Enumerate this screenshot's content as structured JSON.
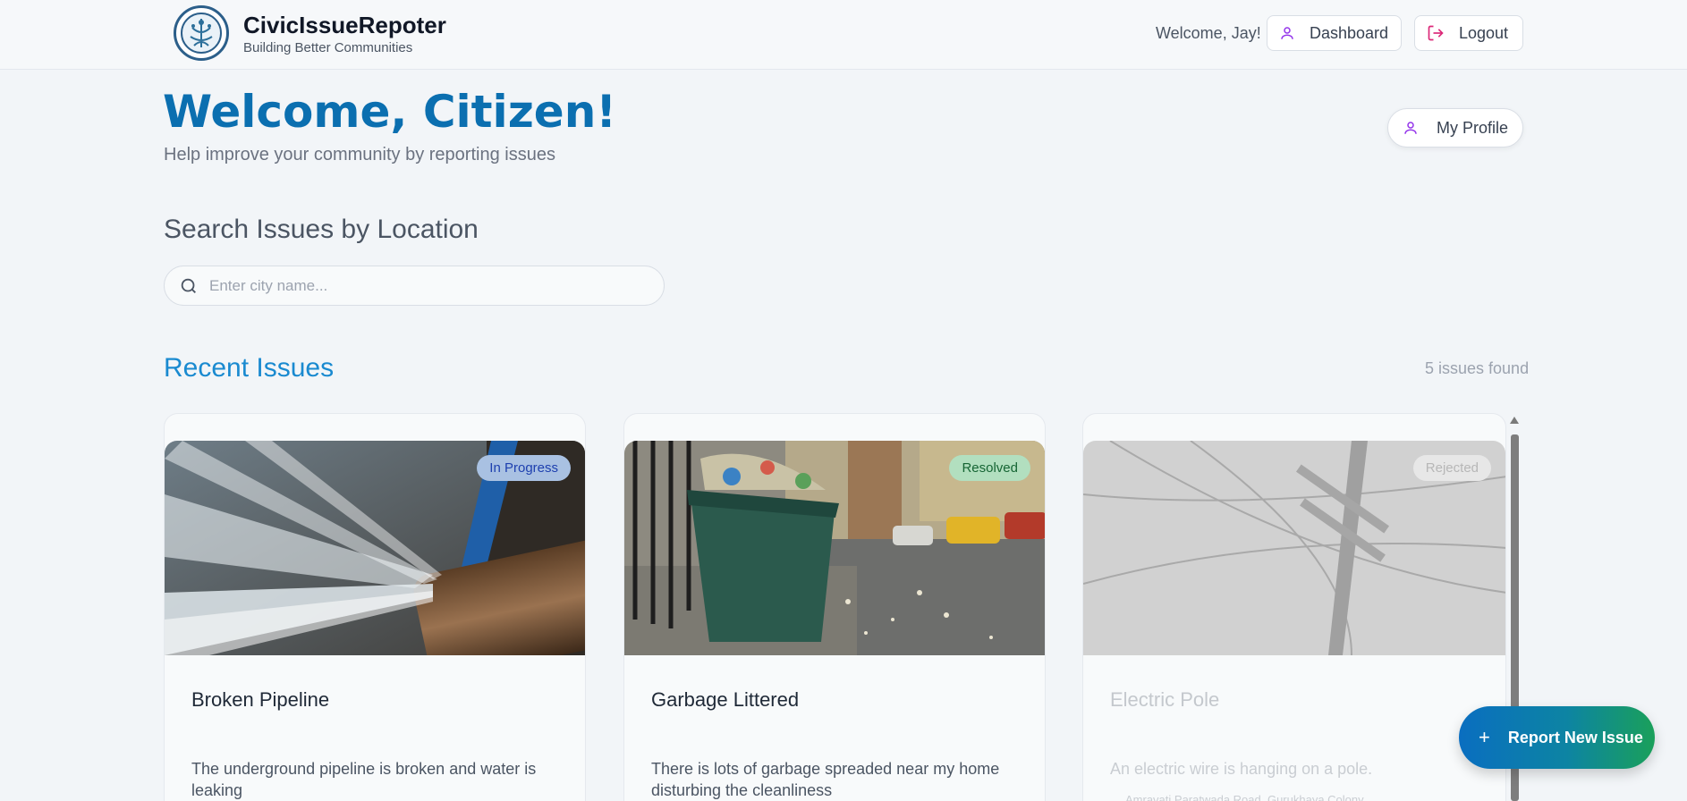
{
  "header": {
    "app_title": "CivicIssueRepoter",
    "tagline": "Building Better Communities",
    "welcome_user": "Welcome, Jay!",
    "dashboard_label": "Dashboard",
    "logout_label": "Logout"
  },
  "hero": {
    "title": "Welcome, Citizen!",
    "subtitle": "Help improve your community by reporting issues",
    "profile_label": "My Profile"
  },
  "search": {
    "title": "Search Issues by Location",
    "placeholder": "Enter city name...",
    "value": ""
  },
  "recent": {
    "title": "Recent Issues",
    "count_text": "5 issues found",
    "issues": [
      {
        "title": "Broken Pipeline",
        "status": "In Progress",
        "description": "The underground pipeline is broken and water is leaking"
      },
      {
        "title": "Garbage Littered",
        "status": "Resolved",
        "description": "There is lots of garbage spreaded near my home disturbing the cleanliness"
      },
      {
        "title": "Electric Pole",
        "status": "Rejected",
        "description": "An electric wire is hanging on a pole.",
        "address": "Amravati Paratwada Road, Gurukhaya Colony"
      }
    ]
  },
  "fab": {
    "label": "Report New Issue"
  },
  "colors": {
    "brand_blue": "#0b6fb0",
    "accent_green": "#1aa05a",
    "status_in_progress": "#a9c1e2",
    "status_resolved": "#b2dfbf",
    "status_rejected": "#e7e7e7"
  },
  "icons": [
    "logo-emblem",
    "user-icon",
    "logout-icon",
    "search-icon",
    "plus-icon"
  ]
}
